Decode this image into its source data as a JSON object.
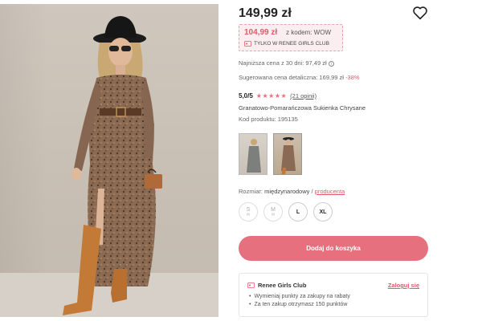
{
  "product": {
    "price": "149,99 zł",
    "promo": {
      "price": "104,99 zł",
      "code_label": "z kodem: WOW",
      "club_label": "TYLKO W RENEE GIRLS CLUB"
    },
    "lowest_price": "Najniższa cena z 30 dni: 97,49 zł",
    "suggested_price": "Sugerowana cena detaliczna: 169,99 zł",
    "discount": "-38%",
    "rating": {
      "score": "5,0/5",
      "stars": "★★★★★",
      "reviews": "(21 opinii)"
    },
    "name": "Granatowo-Pomarańczowa Sukienka Chrysane",
    "code": "Kod produktu: 195135",
    "size_row": {
      "label": "Rozmiar:",
      "value": "międzynarodowy",
      "separator": "/",
      "producer": "producenta"
    },
    "sizes": [
      {
        "label": "S",
        "available": false
      },
      {
        "label": "M",
        "available": false
      },
      {
        "label": "L",
        "available": true
      },
      {
        "label": "XL",
        "available": true
      }
    ],
    "add_to_cart": "Dodaj do koszyka"
  },
  "club": {
    "title": "Renee Girls Club",
    "login": "Zaloguj się",
    "benefits": [
      "Wymieniaj punkty za zakupy na rabaty",
      "Za ten zakup otrzymasz 150 punktów"
    ]
  },
  "icons": {
    "heart": "heart-icon",
    "info": "info-icon",
    "club": "ticket-icon",
    "envelope": "envelope-icon"
  },
  "colors": {
    "accent": "#e6707e",
    "promo_bg": "#fbeef0",
    "promo_border": "#e8a4ac"
  }
}
